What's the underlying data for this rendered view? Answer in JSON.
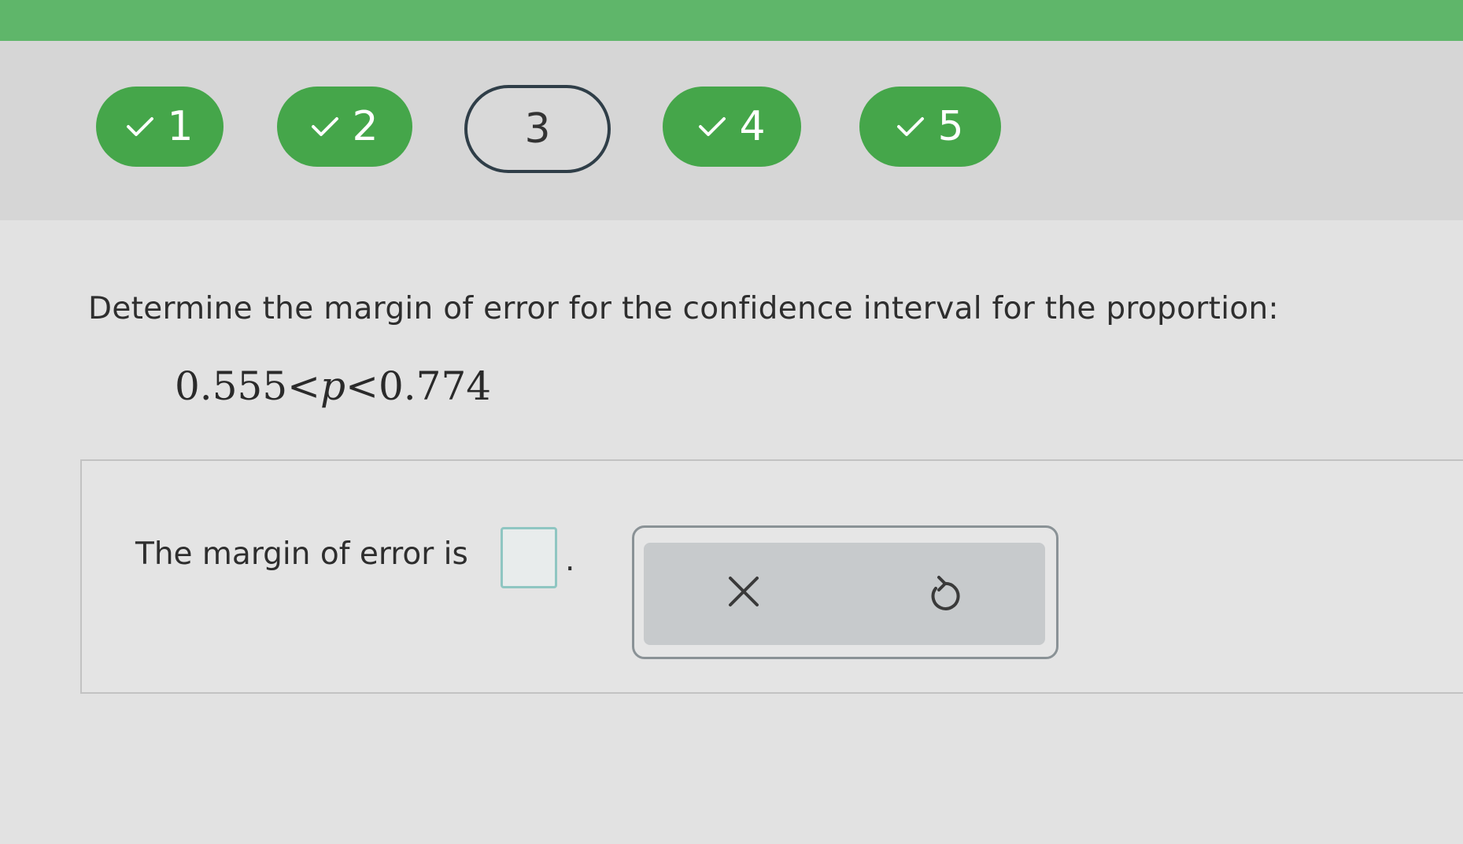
{
  "nav": {
    "items": [
      {
        "label": "1",
        "status": "done"
      },
      {
        "label": "2",
        "status": "done"
      },
      {
        "label": "3",
        "status": "current"
      },
      {
        "label": "4",
        "status": "done"
      },
      {
        "label": "5",
        "status": "done"
      }
    ]
  },
  "question": {
    "prompt": "Determine the margin of error for the confidence interval for the proportion:",
    "formula_left": "0.555",
    "formula_lt1": "<",
    "formula_var": "p",
    "formula_lt2": "<",
    "formula_right": "0.774"
  },
  "answer": {
    "label": "The margin of error is",
    "value": "",
    "suffix": "."
  },
  "tools": {
    "clear_icon": "close-icon",
    "undo_icon": "undo-icon"
  },
  "colors": {
    "top_bar": "#5fb66a",
    "done": "#45a64a",
    "current_border": "#2f3e48",
    "input_border": "#8fc6c2"
  }
}
